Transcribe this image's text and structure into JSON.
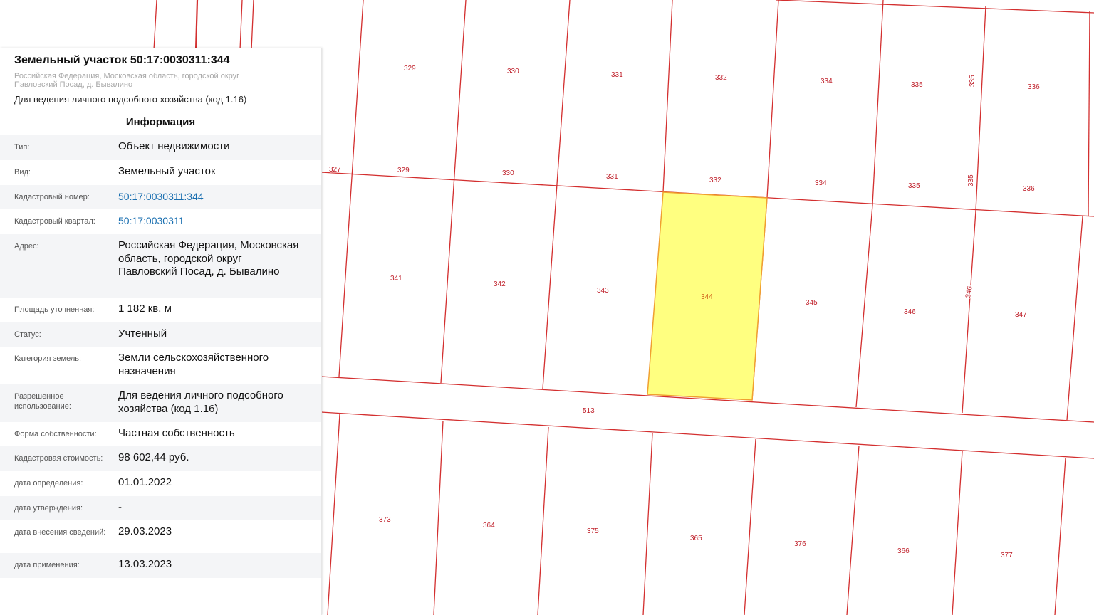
{
  "panel": {
    "title": "Земельный участок 50:17:0030311:344",
    "address_line1": "Российская Федерация, Московская область, городской округ",
    "address_line2": "Павловский Посад, д. Бывалино",
    "purpose": "Для ведения личного подсобного хозяйства (код 1.16)",
    "section_title": "Информация",
    "rows": [
      {
        "key": "Тип:",
        "value": "Объект недвижимости"
      },
      {
        "key": "Вид:",
        "value": "Земельный участок"
      },
      {
        "key": "Кадастровый номер:",
        "value": "50:17:0030311:344"
      },
      {
        "key": "Кадастровый квартал:",
        "value": "50:17:0030311"
      },
      {
        "key": "Адрес:",
        "value": "Российская Федерация, Московская область, городской округ Павловский Посад, д. Бывалино"
      },
      {
        "key": "Площадь уточненная:",
        "value": "1 182 кв. м"
      },
      {
        "key": "Статус:",
        "value": "Учтенный"
      },
      {
        "key": "Категория земель:",
        "value": "Земли сельскохозяйственного назначения"
      },
      {
        "key": "Разрешенное использование:",
        "value": "Для ведения личного подсобного хозяйства (код 1.16)"
      },
      {
        "key": "Форма собственности:",
        "value": "Частная собственность"
      },
      {
        "key": "Кадастровая стоимость:",
        "value": "98 602,44 руб."
      },
      {
        "key": "дата определения:",
        "value": "01.01.2022"
      },
      {
        "key": "дата утверждения:",
        "value": "-"
      },
      {
        "key": "дата внесения сведений:",
        "value": "29.03.2023"
      },
      {
        "key": "дата применения:",
        "value": "13.03.2023"
      }
    ]
  },
  "map": {
    "line_color": "#d32f2f",
    "selected_fill": "#ffff80",
    "selected_stroke": "#f0a030",
    "labels_top_row": [
      "329",
      "330",
      "331",
      "332",
      "334",
      "335",
      "335",
      "336"
    ],
    "labels_upper_mid": [
      "327",
      "329",
      "330",
      "331",
      "332",
      "334",
      "335",
      "335",
      "336"
    ],
    "labels_mid_row": [
      "341",
      "342",
      "343",
      "344",
      "345",
      "346",
      "346",
      "347"
    ],
    "label_road": "513",
    "labels_bottom_row": [
      "373",
      "364",
      "375",
      "365",
      "376",
      "366",
      "377"
    ]
  }
}
